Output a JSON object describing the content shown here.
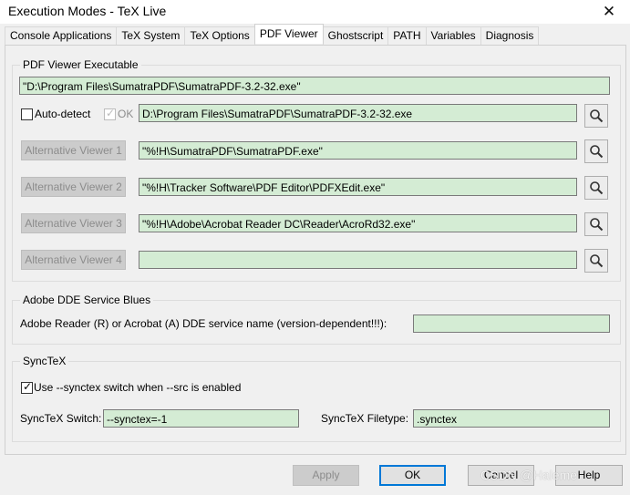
{
  "window": {
    "title": "Execution Modes - TeX Live",
    "close_glyph": "✕"
  },
  "tabs": [
    {
      "label": "Console Applications",
      "active": false
    },
    {
      "label": "TeX System",
      "active": false
    },
    {
      "label": "TeX Options",
      "active": false
    },
    {
      "label": "PDF Viewer",
      "active": true
    },
    {
      "label": "Ghostscript",
      "active": false
    },
    {
      "label": "PATH",
      "active": false
    },
    {
      "label": "Variables",
      "active": false
    },
    {
      "label": "Diagnosis",
      "active": false
    }
  ],
  "pdf_viewer": {
    "group_label": "PDF Viewer Executable",
    "executable_value": "\"D:\\Program Files\\SumatraPDF\\SumatraPDF-3.2-32.exe\"",
    "auto_detect_label": "Auto-detect",
    "ok_label": "OK",
    "auto_detect_value": "D:\\Program Files\\SumatraPDF\\SumatraPDF-3.2-32.exe",
    "alternatives": [
      {
        "button": "Alternative Viewer 1",
        "value": "\"%!H\\SumatraPDF\\SumatraPDF.exe\""
      },
      {
        "button": "Alternative Viewer 2",
        "value": "\"%!H\\Tracker Software\\PDF Editor\\PDFXEdit.exe\""
      },
      {
        "button": "Alternative Viewer 3",
        "value": "\"%!H\\Adobe\\Acrobat Reader DC\\Reader\\AcroRd32.exe\""
      },
      {
        "button": "Alternative Viewer 4",
        "value": ""
      }
    ],
    "search_icon": "magnifier-icon"
  },
  "dde": {
    "group_label": "Adobe DDE Service Blues",
    "service_label": "Adobe Reader (R) or Acrobat (A) DDE service name  (version-dependent!!!):",
    "service_value": ""
  },
  "synctex": {
    "group_label": "SyncTeX",
    "use_label": "Use --synctex switch when --src is enabled",
    "use_checked": true,
    "switch_label": "SyncTeX Switch:",
    "switch_value": "--synctex=-1",
    "filetype_label": "SyncTeX Filetype:",
    "filetype_value": ".synctex"
  },
  "buttons": {
    "apply": "Apply",
    "ok": "OK",
    "cancel": "Cancel",
    "help": "Help"
  },
  "watermark": "CSDN @Haleme",
  "colors": {
    "field_bg": "#d4ecd4",
    "default_button_border": "#0078d7"
  }
}
